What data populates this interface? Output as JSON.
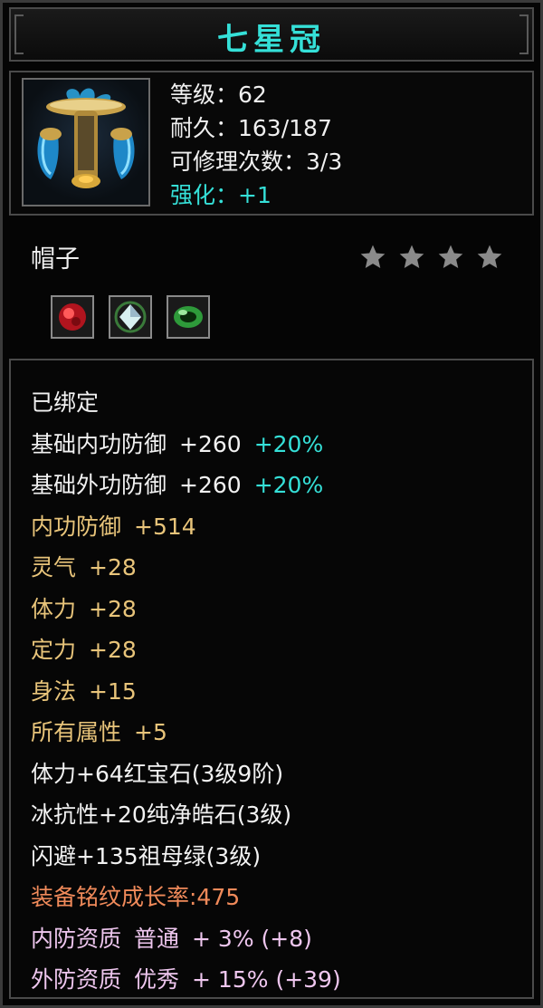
{
  "item": {
    "name": "七星冠",
    "level_line": "等级：62",
    "durability_line": "耐久：163/187",
    "repair_line": "可修理次数：3/3",
    "enhance_line": "强化：+1",
    "type": "帽子",
    "star_count": 4,
    "icon": "crown-helmet-icon"
  },
  "sockets": [
    {
      "name": "ruby-gem-icon",
      "color": "#c8202a"
    },
    {
      "name": "diamond-gem-icon",
      "color": "#cfe8e8"
    },
    {
      "name": "jade-gem-icon",
      "color": "#3aa83a"
    }
  ],
  "attributes": {
    "bound": "已绑定",
    "base_inner_def_label": "基础内功防御",
    "base_inner_def_value": "+260",
    "base_inner_def_bonus": "+20%",
    "base_outer_def_label": "基础外功防御",
    "base_outer_def_value": "+260",
    "base_outer_def_bonus": "+20%",
    "inner_def_label": "内功防御",
    "inner_def_value": "+514",
    "spirit_label": "灵气",
    "spirit_value": "+28",
    "stamina_label": "体力",
    "stamina_value": "+28",
    "focus_label": "定力",
    "focus_value": "+28",
    "agility_label": "身法",
    "agility_value": "+15",
    "all_attr_label": "所有属性",
    "all_attr_value": "+5",
    "gem_line_1": "体力+64红宝石(3级9阶)",
    "gem_line_2": "冰抗性+20纯净皓石(3级)",
    "gem_line_3": "闪避+135祖母绿(3级)",
    "growth_line": "装备铭纹成长率:475",
    "inner_quality_label": "内防资质",
    "inner_quality_grade": "普通",
    "inner_quality_value": "+ 3% (+8)",
    "outer_quality_label": "外防资质",
    "outer_quality_grade": "优秀",
    "outer_quality_value": "+ 15% (+39)"
  },
  "colors": {
    "title": "#35e0d8",
    "white_text": "#f2f2f2",
    "yellow_text": "#e8c47a",
    "orange_text": "#f08a5a",
    "pink_text": "#eec6ee",
    "cyan_text": "#35e0d8"
  }
}
